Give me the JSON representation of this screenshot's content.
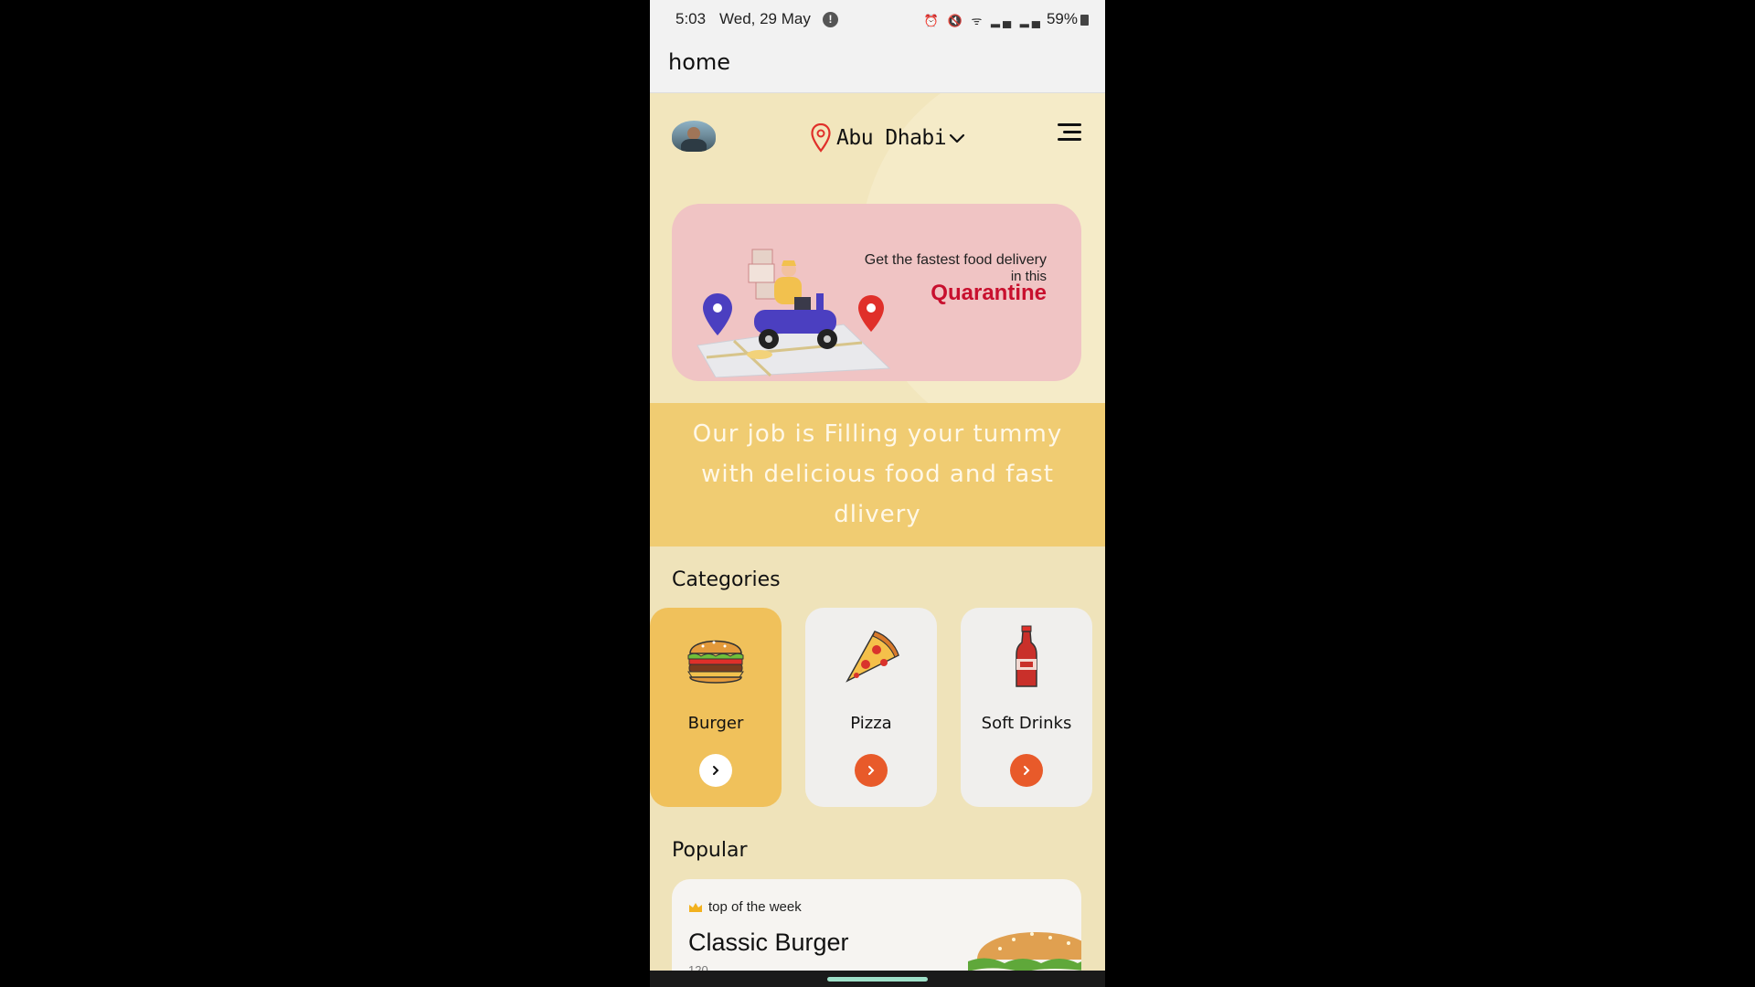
{
  "status_bar": {
    "time": "5:03",
    "date": "Wed, 29 May",
    "battery": "59%",
    "icons": [
      "alarm-icon",
      "mute-icon",
      "wifi-icon",
      "volte-icon",
      "signal-icon",
      "signal-icon",
      "battery-icon"
    ]
  },
  "app_bar": {
    "title": "home"
  },
  "header": {
    "location": "Abu Dhabi"
  },
  "banner": {
    "line1": "Get the fastest food delivery",
    "line2": "in this",
    "highlight": "Quarantine"
  },
  "tagline": "Our job is Filling your tummy with delicious food and fast dlivery",
  "categories": {
    "title": "Categories",
    "items": [
      {
        "label": "Burger",
        "icon": "burger-icon",
        "selected": true
      },
      {
        "label": "Pizza",
        "icon": "pizza-icon",
        "selected": false
      },
      {
        "label": "Soft Drinks",
        "icon": "soda-bottle-icon",
        "selected": false
      }
    ]
  },
  "popular": {
    "title": "Popular",
    "card": {
      "badge": "top of the week",
      "name": "Classic Burger",
      "sub": "120"
    }
  },
  "colors": {
    "accent_orange": "#e85a2a",
    "selected_card": "#f0c15b",
    "banner_pink": "#f0c4c4",
    "quarantine_red": "#c8102e"
  }
}
